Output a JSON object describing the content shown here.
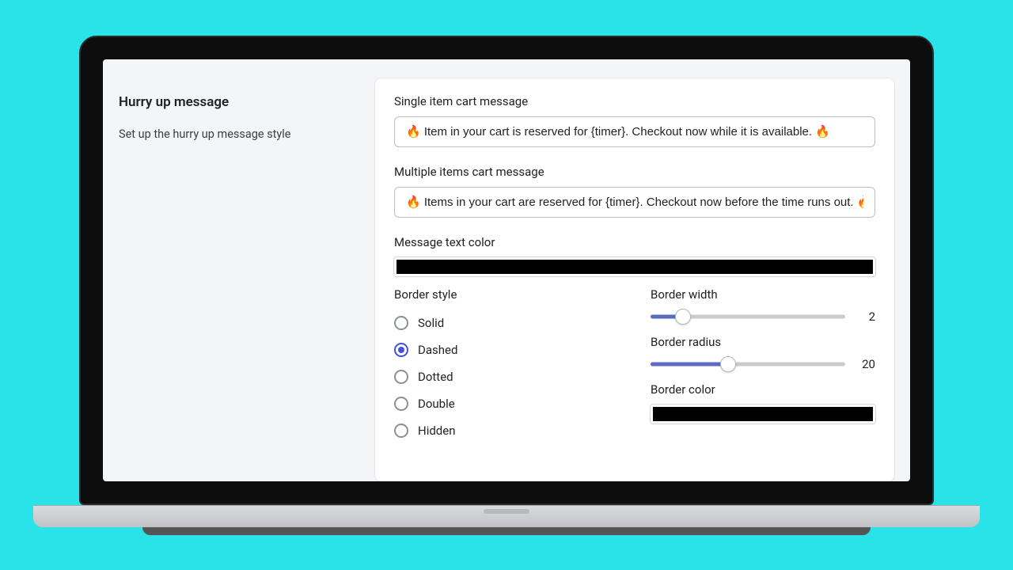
{
  "sidebar": {
    "title": "Hurry up message",
    "description": "Set up the hurry up message style"
  },
  "fields": {
    "single_label": "Single item cart message",
    "single_value": "🔥 Item in your cart is reserved for {timer}. Checkout now while it is available. 🔥",
    "multi_label": "Multiple items cart message",
    "multi_value": "🔥 Items in your cart are reserved for {timer}. Checkout now before the time runs out. 🔥",
    "text_color_label": "Message text color",
    "text_color_value": "#000000"
  },
  "border_style": {
    "label": "Border style",
    "options": [
      "Solid",
      "Dashed",
      "Dotted",
      "Double",
      "Hidden"
    ],
    "selected": "Dashed"
  },
  "border_width": {
    "label": "Border width",
    "value": 2,
    "min": 0,
    "max": 12
  },
  "border_radius": {
    "label": "Border radius",
    "value": 20,
    "min": 0,
    "max": 50
  },
  "border_color": {
    "label": "Border color",
    "value": "#000000"
  }
}
